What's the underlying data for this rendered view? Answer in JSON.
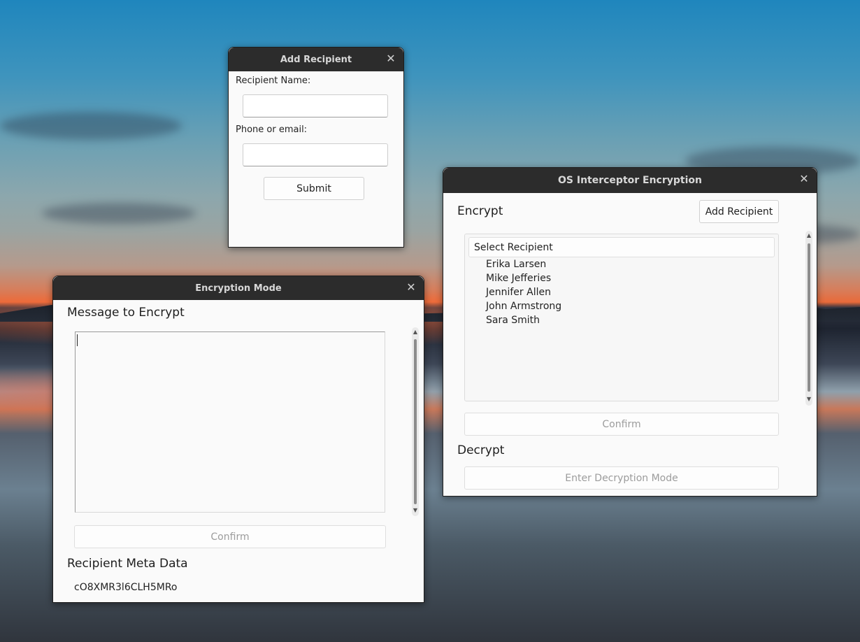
{
  "add_recipient_window": {
    "title": "Add Recipient",
    "name_label": "Recipient Name:",
    "name_value": "",
    "contact_label": "Phone or email:",
    "contact_value": "",
    "submit_label": "Submit"
  },
  "encryption_mode_window": {
    "title": "Encryption Mode",
    "message_heading": "Message to Encrypt",
    "message_value": "",
    "confirm_label": "Confirm",
    "meta_heading": "Recipient Meta Data",
    "meta_value": "cO8XMR3l6CLH5MRo"
  },
  "main_window": {
    "title": "OS Interceptor Encryption",
    "encrypt_heading": "Encrypt",
    "add_recipient_label": "Add Recipient",
    "select_header": "Select Recipient",
    "recipients": [
      "Erika Larsen",
      "Mike Jefferies",
      "Jennifer Allen",
      "John Armstrong",
      "Sara Smith"
    ],
    "confirm_label": "Confirm",
    "decrypt_heading": "Decrypt",
    "decrypt_button_label": "Enter Decryption Mode"
  },
  "icons": {
    "close": "close-icon",
    "scroll_up": "scroll-up-icon",
    "scroll_down": "scroll-down-icon"
  },
  "colors": {
    "titlebar": "#2c2c2c",
    "window_bg": "#fafafa"
  }
}
